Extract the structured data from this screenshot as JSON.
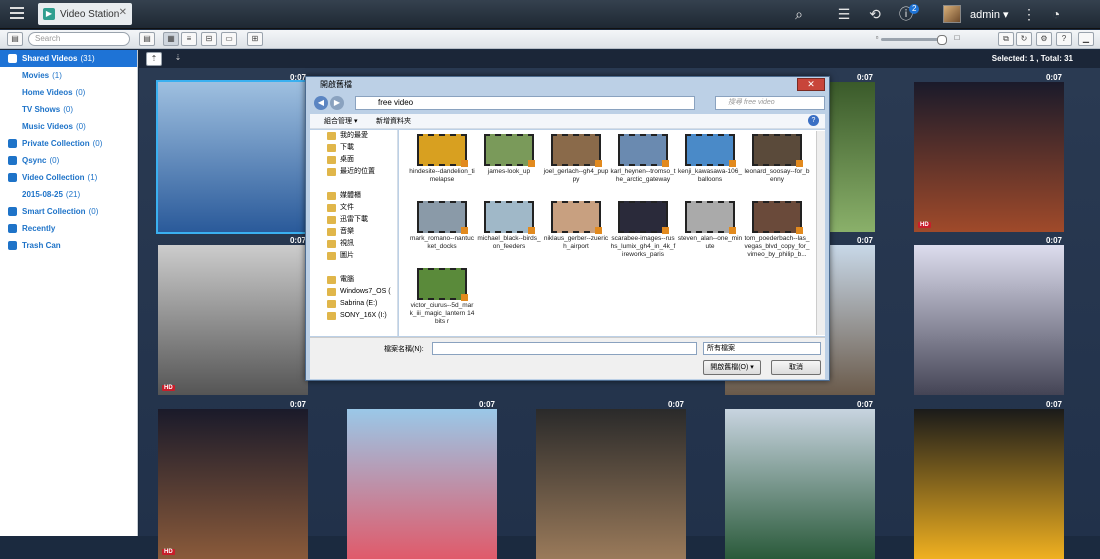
{
  "app": {
    "tab_title": "Video Station",
    "user": "admin",
    "notif_count": "2"
  },
  "search": {
    "placeholder": "Search"
  },
  "sidebar": [
    {
      "label": "Shared Videos",
      "count": "(31)",
      "selected": true,
      "indent": false
    },
    {
      "label": "Movies",
      "count": "(1)",
      "indent": true
    },
    {
      "label": "Home Videos",
      "count": "(0)",
      "indent": true
    },
    {
      "label": "TV Shows",
      "count": "(0)",
      "indent": true
    },
    {
      "label": "Music Videos",
      "count": "(0)",
      "indent": true
    },
    {
      "label": "Private Collection",
      "count": "(0)",
      "indent": false
    },
    {
      "label": "Qsync",
      "count": "(0)",
      "indent": false
    },
    {
      "label": "Video Collection",
      "count": "(1)",
      "indent": false
    },
    {
      "label": "2015-08-25",
      "count": "(21)",
      "indent": true
    },
    {
      "label": "Smart Collection",
      "count": "(0)",
      "indent": false
    },
    {
      "label": "Recently",
      "count": "",
      "indent": false
    },
    {
      "label": "Trash Can",
      "count": "",
      "indent": false
    }
  ],
  "infobar": {
    "selection": "Selected: 1 , Total: 31"
  },
  "thumbs": [
    {
      "dur": "0:07",
      "hd": false
    },
    {
      "dur": "0:07",
      "hd": false
    },
    {
      "dur": "0:07",
      "hd": true
    },
    {
      "dur": "0:07",
      "hd": true
    },
    {
      "dur": "0:07",
      "hd": false
    },
    {
      "dur": "0:07",
      "hd": false
    },
    {
      "dur": "0:07",
      "hd": true
    },
    {
      "dur": "0:07",
      "hd": false
    },
    {
      "dur": "0:07",
      "hd": false
    },
    {
      "dur": "0:07",
      "hd": false
    },
    {
      "dur": "0:07",
      "hd": false
    },
    {
      "dur": "0:07",
      "hd": false
    }
  ],
  "dialog": {
    "title": "開啟舊檔",
    "path": "free video",
    "search_placeholder": "搜尋 free video",
    "organize": "組合管理 ▾",
    "new_folder": "新增資料夾",
    "tree": [
      "我的最愛",
      "下載",
      "桌面",
      "最近的位置",
      "",
      "媒體櫃",
      "文件",
      "迅雷下載",
      "音樂",
      "視訊",
      "圖片",
      "",
      "電腦",
      "Windows7_OS (",
      "Sabrina (E:)",
      "SONY_16X (I:)"
    ],
    "files": [
      "hindesite--dandelion_timelapse",
      "james-look_up",
      "joel_gerlach--gh4_puppy",
      "karl_heynen--tromso_the_arctic_gateway",
      "kenji_kawasawa-106_balloons",
      "leonard_soosay--for_benny",
      "mark_romano--nantucket_docks",
      "michael_black--birds_on_feeders",
      "niklaus_gerber--zuerich_airport",
      "scarabee-images--rushs_lumix_gh4_in_4k_fireworks_paris",
      "steven_alan--one_minute",
      "tom_poederbach--las_vegas_blvd_copy_for_vimeo_by_philip_b...",
      "victor_ciurus--5d_mark_iii_magic_lantern 14 bits r"
    ],
    "filename_label": "檔案名稱(N):",
    "filetype": "所有檔案",
    "open_button": "開啟舊檔(O)",
    "cancel_button": "取消"
  }
}
